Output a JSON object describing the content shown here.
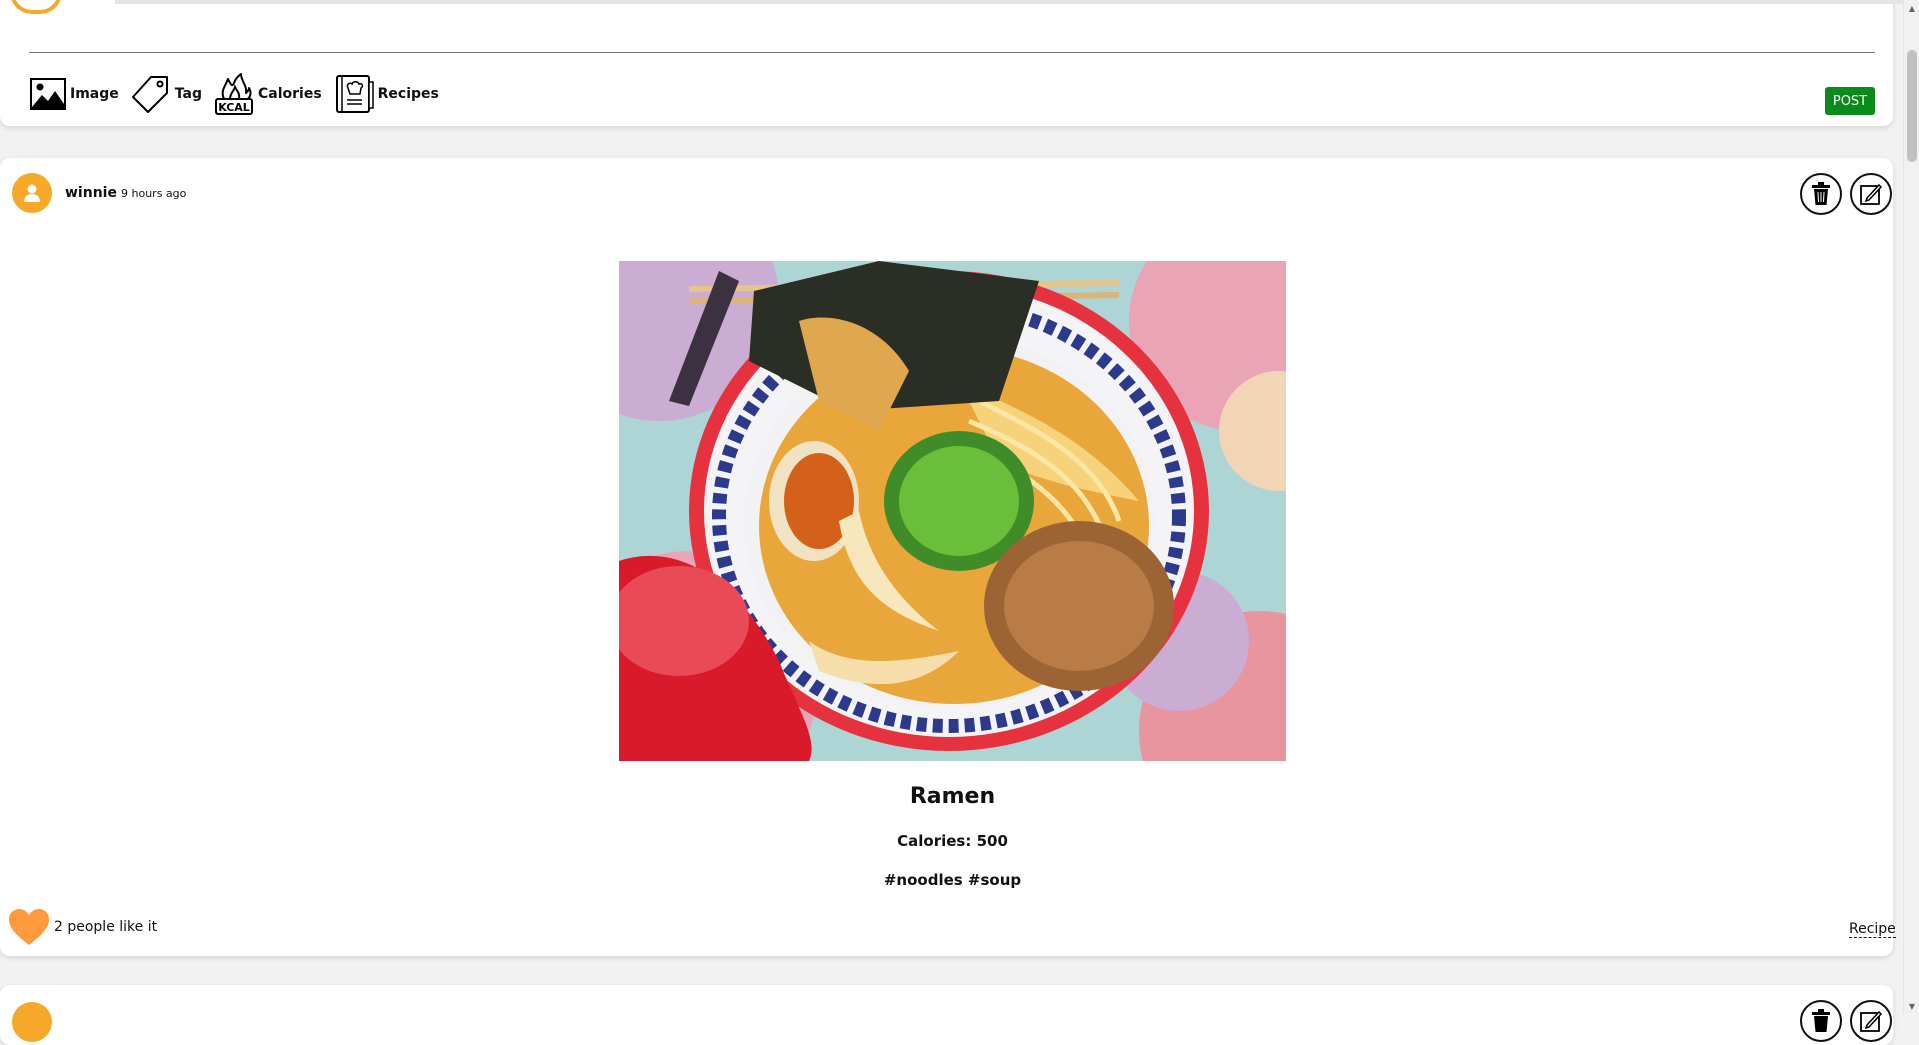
{
  "composer": {
    "tools": [
      {
        "label": "Image",
        "icon": "image-icon"
      },
      {
        "label": "Tag",
        "icon": "tag-icon"
      },
      {
        "label": "Calories",
        "icon": "kcal-fire-icon",
        "icon_text": "KCAL"
      },
      {
        "label": "Recipes",
        "icon": "recipe-book-icon"
      }
    ],
    "post_label": "POST"
  },
  "post": {
    "username": "winnie",
    "time": "9 hours ago",
    "title": "Ramen",
    "calories": "Calories: 500",
    "tags": "#noodles #soup",
    "likes_text": "2 people like it",
    "recipe_link": "Recipe"
  },
  "colors": {
    "accent": "#f6a928",
    "post_button": "#0a8a1a",
    "heart": "#ff9a3c",
    "background": "#f2f2f2"
  }
}
